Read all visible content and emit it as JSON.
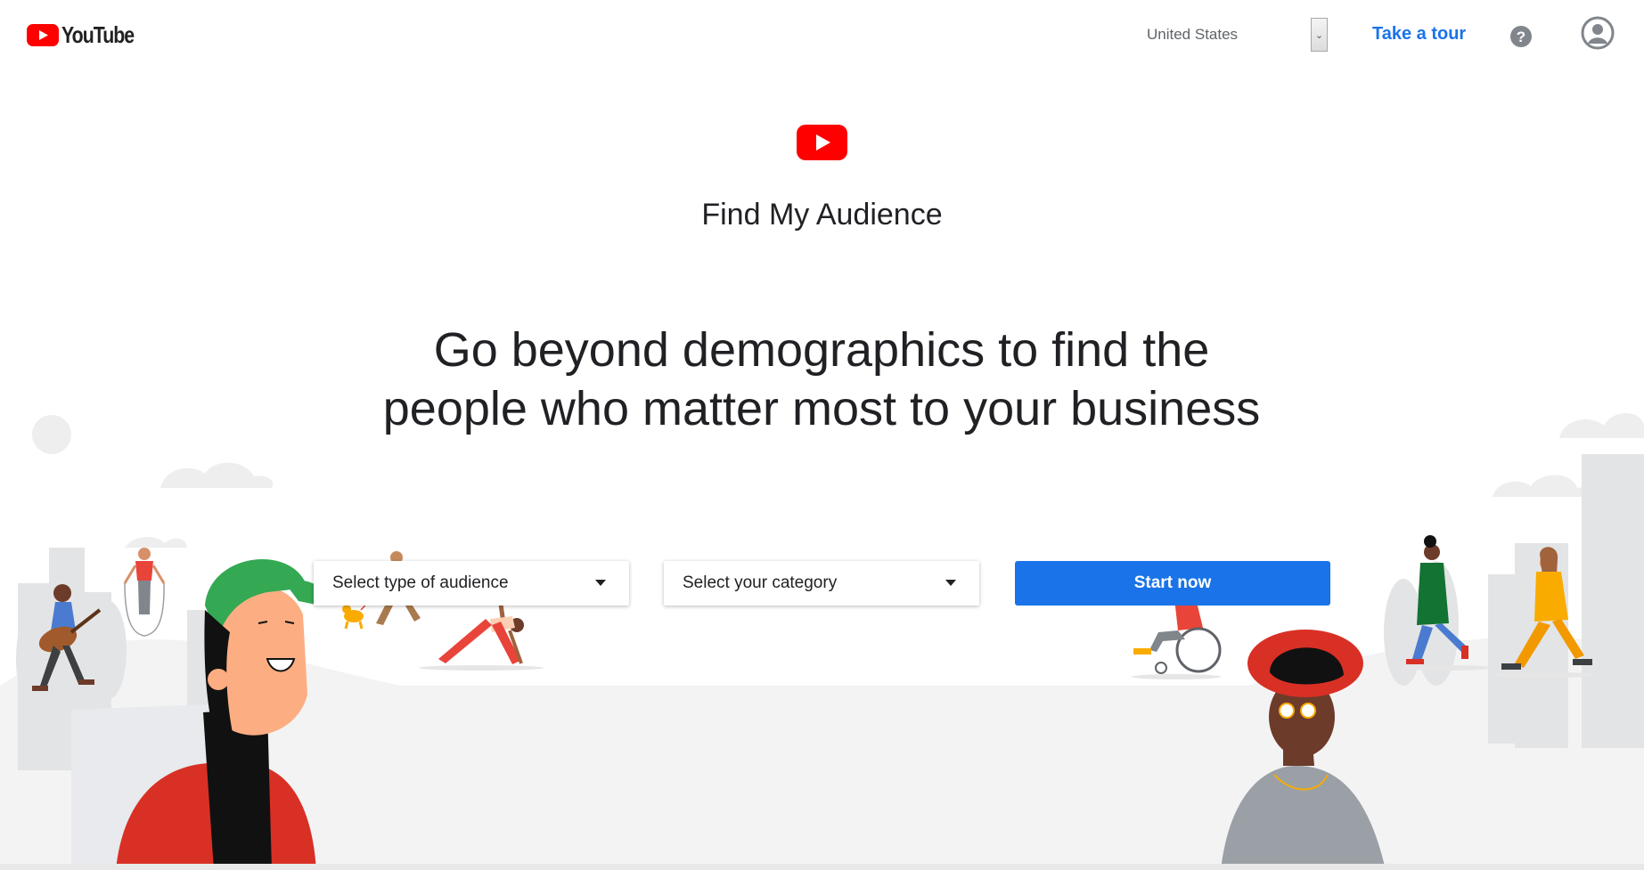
{
  "header": {
    "logo_text": "YouTube",
    "country": "United States",
    "tour_label": "Take a tour",
    "help_icon": "help-circle-icon",
    "account_icon": "account-circle-icon"
  },
  "hero": {
    "app_title": "Find My Audience",
    "headline_line1": "Go beyond demographics to find the",
    "headline_line2": "people who matter most to your business"
  },
  "controls": {
    "audience_placeholder": "Select type of audience",
    "category_placeholder": "Select your category",
    "start_label": "Start now"
  },
  "colors": {
    "brand_red": "#FF0000",
    "accent_blue": "#1A73E8",
    "text_dark": "#202124",
    "text_gray": "#5F6368"
  }
}
